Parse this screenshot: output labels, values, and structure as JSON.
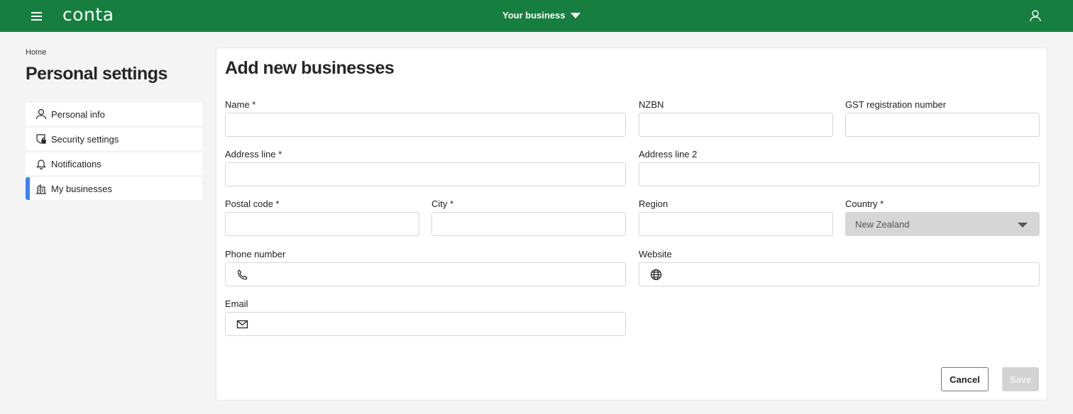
{
  "topbar": {
    "logo": "conta",
    "business_switcher": "Your business",
    "brand_color": "#167f3f"
  },
  "breadcrumb": "Home",
  "page_title": "Personal settings",
  "sidebar": {
    "items": [
      {
        "label": "Personal info",
        "icon": "user-icon",
        "active": false
      },
      {
        "label": "Security settings",
        "icon": "shield-lock-icon",
        "active": false
      },
      {
        "label": "Notifications",
        "icon": "bell-icon",
        "active": false
      },
      {
        "label": "My businesses",
        "icon": "building-icon",
        "active": true
      }
    ],
    "active_color": "#3b82f6"
  },
  "form": {
    "title": "Add new businesses",
    "fields": {
      "name": {
        "label": "Name *",
        "value": ""
      },
      "nzbn": {
        "label": "NZBN",
        "value": ""
      },
      "gst": {
        "label": "GST registration number",
        "value": ""
      },
      "address1": {
        "label": "Address line *",
        "value": ""
      },
      "address2": {
        "label": "Address line 2",
        "value": ""
      },
      "postal": {
        "label": "Postal code *",
        "value": ""
      },
      "city": {
        "label": "City *",
        "value": ""
      },
      "region": {
        "label": "Region",
        "value": ""
      },
      "country": {
        "label": "Country *",
        "value": "New Zealand"
      },
      "phone": {
        "label": "Phone number",
        "value": ""
      },
      "website": {
        "label": "Website",
        "value": ""
      },
      "email": {
        "label": "Email",
        "value": ""
      }
    },
    "cancel_label": "Cancel",
    "save_label": "Save"
  }
}
